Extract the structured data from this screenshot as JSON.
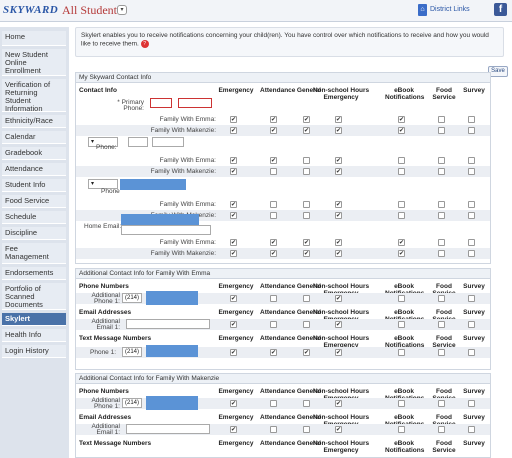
{
  "app": {
    "logo": "SKYWARD",
    "title": "All Students",
    "district_links": "District Links",
    "fb": "f"
  },
  "sidebar": [
    "Home",
    "New Student Online Enrollment",
    "Verification of Returning Student Information",
    "Ethnicity/Race",
    "Calendar",
    "Gradebook",
    "Attendance",
    "Student Info",
    "Food Service",
    "Schedule",
    "Discipline",
    "Fee Management",
    "Endorsements",
    "Portfolio of Scanned Documents",
    "Skylert",
    "Health Info",
    "Login History"
  ],
  "message": "Skylert enables you to receive notifications concerning your child(ren). You have control over which notifications to receive and how you would like to receive them.",
  "save": "Save",
  "columns": [
    "Emergency",
    "Attendance",
    "General",
    "Non-school Hours Emergency",
    "eBook Notifications",
    "Food Service",
    "Survey"
  ],
  "contact": {
    "section_title": "My Skyward Contact Info",
    "header": "Contact Info",
    "primary_phone": "* Primary Phone:",
    "phone": "Phone:",
    "phone2": "Phone",
    "home_email": "Home Email:",
    "family_emma": "Family With Emma:",
    "family_makenzie": "Family With Makenzie:"
  },
  "emma": {
    "section_title": "Additional Contact Info for Family With Emma",
    "phone_numbers": "Phone Numbers",
    "additional_phone": "Additional Phone 1:",
    "email_addresses": "Email Addresses",
    "additional_email": "Additional Email 1:",
    "text_message": "Text Message Numbers",
    "phone1": "Phone 1:",
    "area": "(214)"
  },
  "makenzie": {
    "section_title": "Additional Contact Info for Family With Makenzie",
    "phone_numbers": "Phone Numbers",
    "additional_phone": "Additional Phone 1:",
    "email_addresses": "Email Addresses",
    "additional_email": "Additional Email 1:",
    "text_message": "Text Message Numbers",
    "area": "(214)"
  },
  "colors": {
    "accent": "#2a56a6",
    "sidebar_active": "#4a72a8",
    "redacted": "#5b93d6"
  }
}
